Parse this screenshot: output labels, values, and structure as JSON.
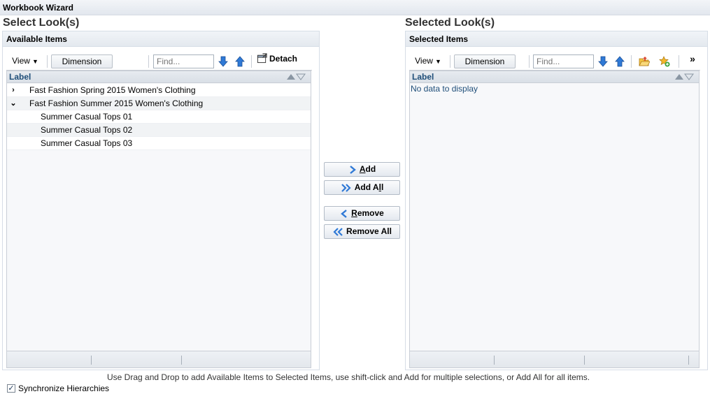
{
  "window": {
    "title": "Workbook Wizard"
  },
  "left": {
    "section_title": "Select Look(s)",
    "panel_title": "Available Items",
    "toolbar": {
      "view_label": "View",
      "dimension_label": "Dimension",
      "find_placeholder": "Find...",
      "detach_label": "Detach"
    },
    "column_header": "Label",
    "rows": [
      {
        "label": "Fast Fashion Spring 2015 Women's Clothing",
        "expander": "›",
        "level": 0
      },
      {
        "label": "Fast Fashion Summer 2015 Women's Clothing",
        "expander": "⌄",
        "level": 0
      },
      {
        "label": "Summer Casual Tops 01",
        "expander": "",
        "level": 1
      },
      {
        "label": "Summer Casual Tops 02",
        "expander": "",
        "level": 1
      },
      {
        "label": "Summer Casual Tops 03",
        "expander": "",
        "level": 1
      }
    ]
  },
  "right": {
    "section_title": "Selected Look(s)",
    "panel_title": "Selected Items",
    "toolbar": {
      "view_label": "View",
      "dimension_label": "Dimension",
      "find_placeholder": "Find...",
      "more_label": "»"
    },
    "column_header": "Label",
    "empty_text": "No data to display"
  },
  "shuttle": {
    "add": {
      "pre": "",
      "u": "A",
      "post": "dd"
    },
    "add_all": {
      "pre": "Add A",
      "u": "l",
      "post": "l"
    },
    "remove": {
      "pre": "",
      "u": "R",
      "post": "emove"
    },
    "remove_all": {
      "pre": "Remove",
      "u": "",
      "post": " All"
    }
  },
  "hint_text": "Use Drag and Drop to add Available Items to Selected Items, use shift-click and Add for multiple selections, or Add All for all items.",
  "sync_checkbox": {
    "label": "Synchronize Hierarchies",
    "checked": true,
    "check_glyph": "✓"
  },
  "colors": {
    "accent": "#1f4e79",
    "arrow_blue": "#2f79d6",
    "header_bg": "#e4e9ef"
  }
}
